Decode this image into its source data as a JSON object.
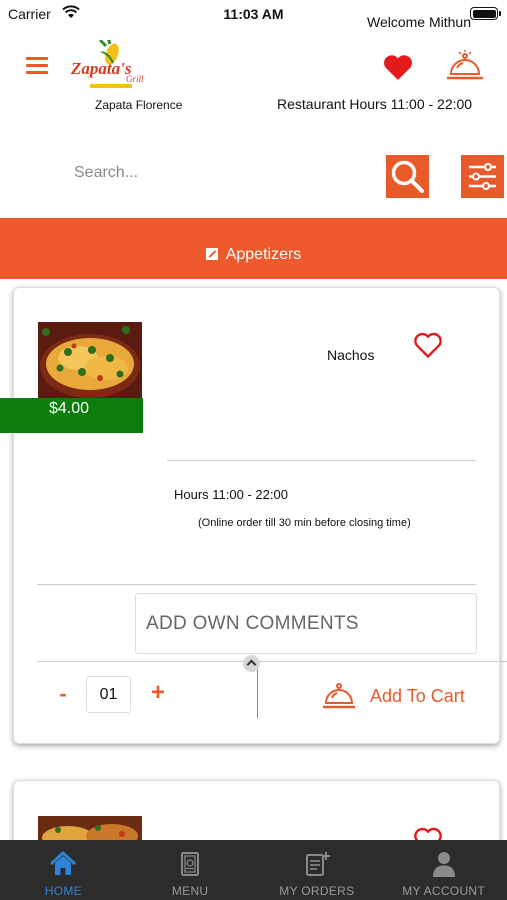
{
  "status_bar": {
    "carrier": "Carrier",
    "time": "11:03 AM"
  },
  "header": {
    "welcome_text": "Welcome Mithun",
    "logo_text": "Zapata's",
    "logo_subtext": "Grill",
    "store_name": "Zapata Florence",
    "restaurant_hours": "Restaurant Hours 11:00 - 22:00"
  },
  "search": {
    "placeholder": "Search..."
  },
  "category": {
    "label": "Appetizers"
  },
  "products": [
    {
      "name": "Nachos",
      "price": "$4.00",
      "hours": "Hours 11:00 - 22:00",
      "order_note": "(Online order till 30 min before closing time)",
      "comments_placeholder": "ADD OWN COMMENTS",
      "quantity": "01",
      "minus_label": "-",
      "plus_label": "+",
      "add_to_cart_label": "Add To Cart"
    }
  ],
  "tabs": [
    {
      "label": "HOME",
      "icon": "home-icon",
      "active": true
    },
    {
      "label": "MENU",
      "icon": "menu-book-icon",
      "active": false
    },
    {
      "label": "MY ORDERS",
      "icon": "orders-icon",
      "active": false
    },
    {
      "label": "MY ACCOUNT",
      "icon": "account-icon",
      "active": false
    }
  ],
  "colors": {
    "accent": "#ee5a2c",
    "price_badge": "#0a7d0a",
    "tab_active": "#2f84d8",
    "tab_bar": "#2c2c2c"
  }
}
